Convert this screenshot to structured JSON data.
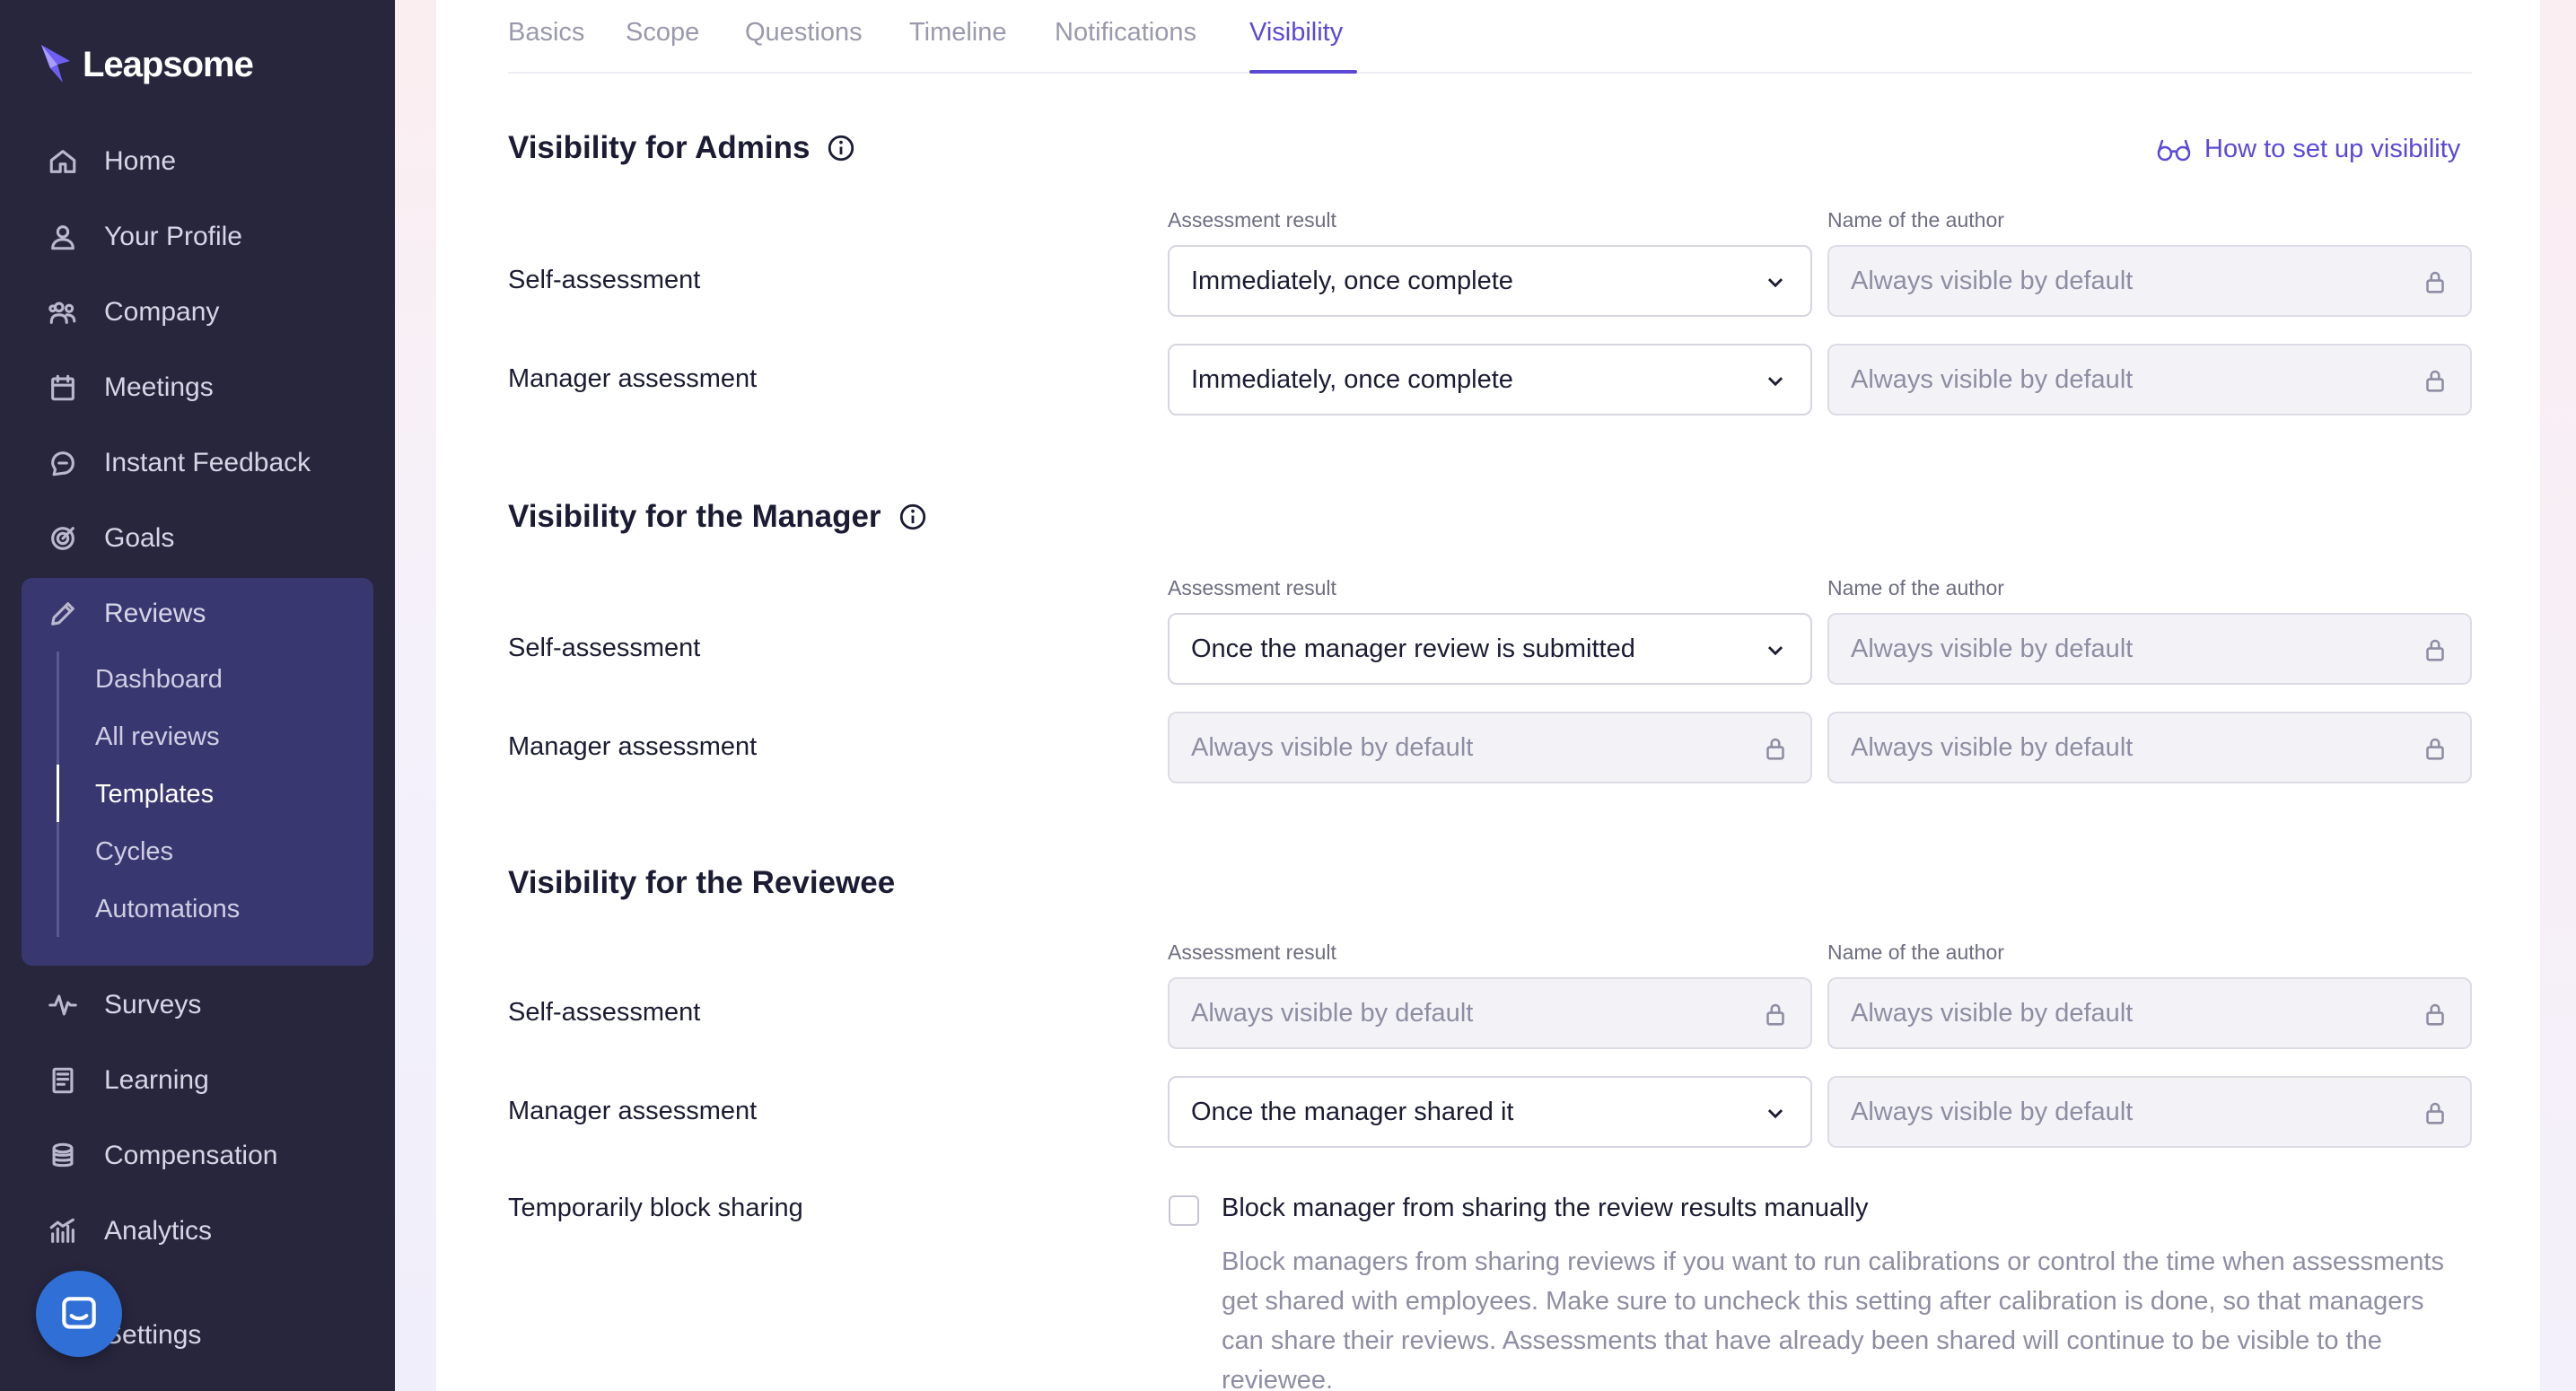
{
  "app": {
    "logo_text": "Leapsome"
  },
  "sidebar": {
    "items": [
      {
        "label": "Home",
        "icon": "home-icon"
      },
      {
        "label": "Your Profile",
        "icon": "user-icon"
      },
      {
        "label": "Company",
        "icon": "users-icon"
      },
      {
        "label": "Meetings",
        "icon": "calendar-icon"
      },
      {
        "label": "Instant Feedback",
        "icon": "chat-icon"
      },
      {
        "label": "Goals",
        "icon": "target-icon"
      },
      {
        "label": "Reviews",
        "icon": "pencil-icon"
      },
      {
        "label": "Surveys",
        "icon": "pulse-icon"
      },
      {
        "label": "Learning",
        "icon": "book-icon"
      },
      {
        "label": "Compensation",
        "icon": "coins-icon"
      },
      {
        "label": "Analytics",
        "icon": "chart-icon"
      },
      {
        "label": "Settings",
        "icon": "gear-icon"
      }
    ],
    "reviews_sub": [
      "Dashboard",
      "All reviews",
      "Templates",
      "Cycles",
      "Automations"
    ],
    "active_sub": "Templates"
  },
  "tabs": [
    "Basics",
    "Scope",
    "Questions",
    "Timeline",
    "Notifications",
    "Visibility"
  ],
  "active_tab": "Visibility",
  "help_link": "How to set up visibility",
  "columns": {
    "result": "Assessment result",
    "author": "Name of the author"
  },
  "sections": {
    "admins": {
      "title": "Visibility for Admins",
      "rows": [
        {
          "label": "Self-assessment",
          "result": "Immediately, once complete",
          "author": "Always visible by default"
        },
        {
          "label": "Manager assessment",
          "result": "Immediately, once complete",
          "author": "Always visible by default"
        }
      ]
    },
    "manager": {
      "title": "Visibility for the Manager",
      "rows": [
        {
          "label": "Self-assessment",
          "result": "Once the manager review is submitted",
          "author": "Always visible by default"
        },
        {
          "label": "Manager assessment",
          "result": "Always visible by default",
          "author": "Always visible by default"
        }
      ]
    },
    "reviewee": {
      "title": "Visibility for the Reviewee",
      "rows": [
        {
          "label": "Self-assessment",
          "result": "Always visible by default",
          "author": "Always visible by default"
        },
        {
          "label": "Manager assessment",
          "result": "Once the manager shared it",
          "author": "Always visible by default"
        }
      ]
    }
  },
  "block_sharing": {
    "label": "Temporarily block sharing",
    "checkbox_label": "Block manager from sharing the review results manually",
    "checked": false,
    "description": "Block managers from sharing reviews if you want to run calibrations or control the time when assessments get shared with employees. Make sure to uncheck this setting after calibration is done, so that managers can share their reviews. Assessments that have already been shared will continue to be visible to the reviewee."
  },
  "colors": {
    "accent": "#5b49d6",
    "sidebar_bg": "#27263d",
    "reviews_bg": "#383770",
    "chat_button": "#2f6fd6"
  }
}
